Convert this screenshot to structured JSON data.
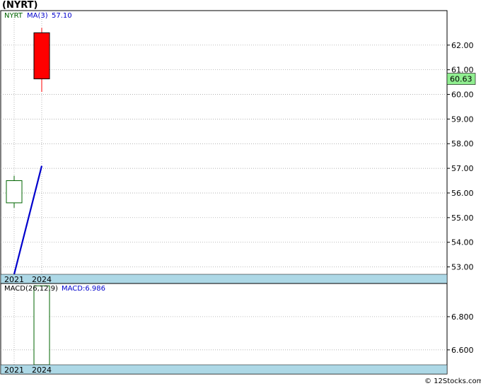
{
  "title": "(NYRT)",
  "credit": "© 12Stocks.com",
  "colors": {
    "up": "#006400",
    "down": "#ff0000",
    "ma": "#0000cc",
    "band": "#add8e6",
    "grid": "#999999",
    "last_bg": "#90ee90"
  },
  "chart_data": [
    {
      "type": "candlestick",
      "legend": {
        "symbol": "NYRT",
        "ma_label": "MA(3)",
        "ma_value": "57.10"
      },
      "categories": [
        "2021",
        "2024"
      ],
      "candles": [
        {
          "x": "2021",
          "open": 55.6,
          "high": 56.7,
          "low": 55.4,
          "close": 56.5,
          "direction": "up"
        },
        {
          "x": "2024",
          "open": 62.5,
          "high": 62.7,
          "low": 60.1,
          "close": 60.63,
          "direction": "down"
        }
      ],
      "ma_series": {
        "name": "MA(3)",
        "values": [
          52.7,
          57.1
        ]
      },
      "ylim": [
        52.7,
        63.4
      ],
      "yticks": [
        "53.00",
        "54.00",
        "55.00",
        "56.00",
        "57.00",
        "58.00",
        "59.00",
        "60.00",
        "61.00",
        "62.00"
      ],
      "last_value": "60.63",
      "grid": true
    },
    {
      "type": "bar",
      "legend": {
        "label": "MACD(26,12,9)",
        "value_label": "MACD:6.986"
      },
      "categories": [
        "2021",
        "2024"
      ],
      "values": [
        null,
        6.986
      ],
      "ylim": [
        6.51,
        7.0
      ],
      "yticks": [
        "6.600",
        "6.800"
      ],
      "grid": true
    }
  ]
}
